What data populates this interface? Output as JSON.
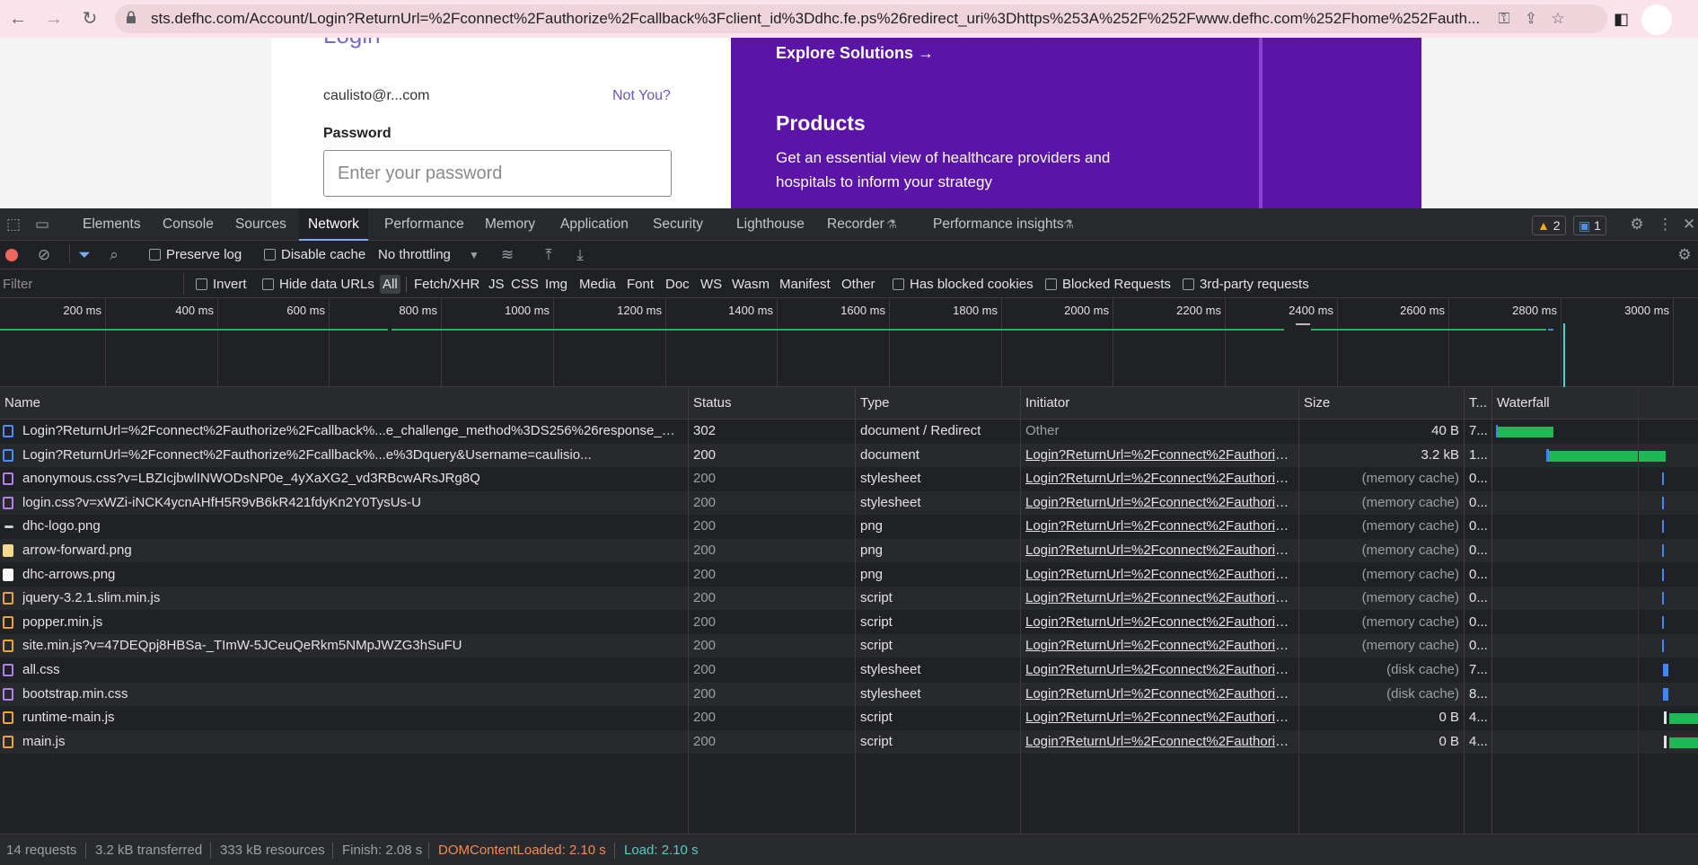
{
  "browser": {
    "url": "sts.defhc.com/Account/Login?ReturnUrl=%2Fconnect%2Fauthorize%2Fcallback%3Fclient_id%3Ddhc.fe.ps%26redirect_uri%3Dhttps%253A%252F%252Fwww.defhc.com%252Fhome%252Fauth..."
  },
  "page": {
    "login_title": "Login",
    "email": "caulisto@r...com",
    "not_you": "Not You?",
    "password_label": "Password",
    "password_placeholder": "Enter your password",
    "explore": "Explore Solutions →",
    "products_title": "Products",
    "products_desc": "Get an essential view of healthcare providers and hospitals to inform your strategy"
  },
  "devtools": {
    "tabs": [
      "Elements",
      "Console",
      "Sources",
      "Network",
      "Performance",
      "Memory",
      "Application",
      "Security",
      "Lighthouse",
      "Recorder",
      "Performance insights"
    ],
    "warnings": "2",
    "issues": "1",
    "toolbar": {
      "preserve_log": "Preserve log",
      "disable_cache": "Disable cache",
      "throttling": "No throttling"
    },
    "filter": {
      "placeholder": "Filter",
      "invert": "Invert",
      "hide_data_urls": "Hide data URLs",
      "types": [
        "All",
        "Fetch/XHR",
        "JS",
        "CSS",
        "Img",
        "Media",
        "Font",
        "Doc",
        "WS",
        "Wasm",
        "Manifest",
        "Other"
      ],
      "has_blocked_cookies": "Has blocked cookies",
      "blocked_requests": "Blocked Requests",
      "third_party": "3rd-party requests"
    },
    "overview_ticks": [
      "200 ms",
      "400 ms",
      "600 ms",
      "800 ms",
      "1000 ms",
      "1200 ms",
      "1400 ms",
      "1600 ms",
      "1800 ms",
      "2000 ms",
      "2200 ms",
      "2400 ms",
      "2600 ms",
      "2800 ms",
      "3000 ms"
    ],
    "columns": {
      "name": "Name",
      "status": "Status",
      "type": "Type",
      "initiator": "Initiator",
      "size": "Size",
      "time": "T...",
      "waterfall": "Waterfall"
    },
    "requests": [
      {
        "name": "Login?ReturnUrl=%2Fconnect%2Fauthorize%2Fcallback%...e_challenge_method%3DS256%26response_mode...",
        "status": "302",
        "type": "document / Redirect",
        "initiator": "Other",
        "size": "40 B",
        "time": "7...",
        "icon": "doc"
      },
      {
        "name": "Login?ReturnUrl=%2Fconnect%2Fauthorize%2Fcallback%...e%3Dquery&Username=caulisio...",
        "status": "200",
        "type": "document",
        "initiator": "Login?ReturnUrl=%2Fconnect%2Fauthorize...",
        "size": "3.2 kB",
        "time": "1...",
        "icon": "doc"
      },
      {
        "name": "anonymous.css?v=LBZIcjbwlINWODsNP0e_4yXaXG2_vd3RBcwARsJRg8Q",
        "status": "200",
        "type": "stylesheet",
        "initiator": "Login?ReturnUrl=%2Fconnect%2Fauthorize...",
        "size": "(memory cache)",
        "time": "0...",
        "icon": "css"
      },
      {
        "name": "login.css?v=xWZi-iNCK4ycnAHfH5R9vB6kR421fdyKn2Y0TysUs-U",
        "status": "200",
        "type": "stylesheet",
        "initiator": "Login?ReturnUrl=%2Fconnect%2Fauthorize...",
        "size": "(memory cache)",
        "time": "0...",
        "icon": "css"
      },
      {
        "name": "dhc-logo.png",
        "status": "200",
        "type": "png",
        "initiator": "Login?ReturnUrl=%2Fconnect%2Fauthorize...",
        "size": "(memory cache)",
        "time": "0...",
        "icon": "img-logo"
      },
      {
        "name": "arrow-forward.png",
        "status": "200",
        "type": "png",
        "initiator": "Login?ReturnUrl=%2Fconnect%2Fauthorize...",
        "size": "(memory cache)",
        "time": "0...",
        "icon": "img-arrow"
      },
      {
        "name": "dhc-arrows.png",
        "status": "200",
        "type": "png",
        "initiator": "Login?ReturnUrl=%2Fconnect%2Fauthorize...",
        "size": "(memory cache)",
        "time": "0...",
        "icon": "img-white"
      },
      {
        "name": "jquery-3.2.1.slim.min.js",
        "status": "200",
        "type": "script",
        "initiator": "Login?ReturnUrl=%2Fconnect%2Fauthorize...",
        "size": "(memory cache)",
        "time": "0...",
        "icon": "js"
      },
      {
        "name": "popper.min.js",
        "status": "200",
        "type": "script",
        "initiator": "Login?ReturnUrl=%2Fconnect%2Fauthorize...",
        "size": "(memory cache)",
        "time": "0...",
        "icon": "js"
      },
      {
        "name": "site.min.js?v=47DEQpj8HBSa-_TImW-5JCeuQeRkm5NMpJWZG3hSuFU",
        "status": "200",
        "type": "script",
        "initiator": "Login?ReturnUrl=%2Fconnect%2Fauthorize...",
        "size": "(memory cache)",
        "time": "0...",
        "icon": "js"
      },
      {
        "name": "all.css",
        "status": "200",
        "type": "stylesheet",
        "initiator": "Login?ReturnUrl=%2Fconnect%2Fauthorize...",
        "size": "(disk cache)",
        "time": "7...",
        "icon": "css"
      },
      {
        "name": "bootstrap.min.css",
        "status": "200",
        "type": "stylesheet",
        "initiator": "Login?ReturnUrl=%2Fconnect%2Fauthorize...",
        "size": "(disk cache)",
        "time": "8...",
        "icon": "css"
      },
      {
        "name": "runtime-main.js",
        "status": "200",
        "type": "script",
        "initiator": "Login?ReturnUrl=%2Fconnect%2Fauthorize...",
        "size": "0 B",
        "time": "4...",
        "icon": "js"
      },
      {
        "name": "main.js",
        "status": "200",
        "type": "script",
        "initiator": "Login?ReturnUrl=%2Fconnect%2Fauthorize...",
        "size": "0 B",
        "time": "4...",
        "icon": "js"
      }
    ],
    "status_bar": {
      "requests": "14 requests",
      "transferred": "3.2 kB transferred",
      "resources": "333 kB resources",
      "finish": "Finish: 2.08 s",
      "dom_loaded": "DOMContentLoaded: 2.10 s",
      "load": "Load: 2.10 s"
    }
  },
  "colors": {
    "topbar_bg": "#fae3ea",
    "promo_purple": "#5a14a7",
    "login_accent": "#6d54c8",
    "waterfall_green": "#1db954",
    "dom_loaded": "#f28b54",
    "load": "#5cc9c5"
  }
}
